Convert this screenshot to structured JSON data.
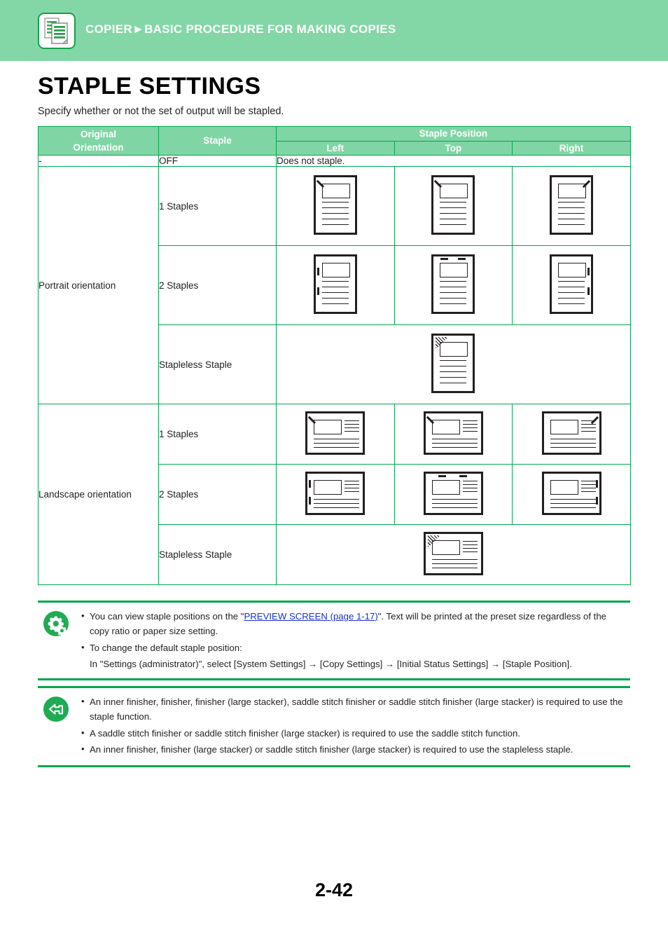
{
  "header": {
    "breadcrumb": "COPIER►BASIC PROCEDURE FOR MAKING COPIES",
    "icon": "copier-documents-icon",
    "band_color": "#83d7a6"
  },
  "page": {
    "title": "STAPLE SETTINGS",
    "subtitle": "Specify whether or not the set of output will be stapled.",
    "number": "2-42"
  },
  "table": {
    "headers": {
      "original_orientation": "Original\nOrientation",
      "original_orientation_line1": "Original",
      "original_orientation_line2": "Orientation",
      "staple": "Staple",
      "staple_position": "Staple Position",
      "left": "Left",
      "top": "Top",
      "right": "Right"
    },
    "rows": [
      {
        "orientation": "-",
        "staple": "OFF",
        "span_text": "Does not staple.",
        "type": "text"
      },
      {
        "orientation": "Portrait orientation",
        "staple": "1 Staples",
        "type": "illustration",
        "sheet": "portrait",
        "marks": [
          "diag-top-left",
          "diag-top-left",
          "diag-top-right"
        ]
      },
      {
        "orientation": "Portrait orientation",
        "staple": "2 Staples",
        "type": "illustration",
        "sheet": "portrait",
        "marks": [
          "two-vertical-left",
          "two-horizontal-top",
          "two-vertical-right"
        ]
      },
      {
        "orientation": "Portrait orientation",
        "staple": "Stapleless Staple",
        "type": "illustration-center",
        "sheet": "portrait",
        "marks": [
          "crimp-top-left"
        ]
      },
      {
        "orientation": "Landscape orientation",
        "staple": "1 Staples",
        "type": "illustration",
        "sheet": "landscape",
        "marks": [
          "diag-top-left",
          "diag-top-left",
          "diag-top-right"
        ]
      },
      {
        "orientation": "Landscape orientation",
        "staple": "2 Staples",
        "type": "illustration",
        "sheet": "landscape",
        "marks": [
          "two-vertical-left",
          "two-horizontal-top",
          "two-vertical-right"
        ]
      },
      {
        "orientation": "Landscape orientation",
        "staple": "Stapleless Staple",
        "type": "illustration-center",
        "sheet": "landscape",
        "marks": [
          "crimp-top-left"
        ]
      }
    ],
    "orientation_labels": {
      "portrait": "Portrait orientation",
      "landscape": "Landscape orientation"
    },
    "staple_labels": {
      "off": "OFF",
      "one": "1 Staples",
      "two": "2 Staples",
      "stapleless": "Stapleless Staple"
    },
    "off_description": "Does not staple."
  },
  "notes": [
    {
      "icon": "gears-icon",
      "icon_color": "#1eab54",
      "items": [
        {
          "pre": "You can view staple positions on the \"",
          "link": "PREVIEW SCREEN (page 1-17)",
          "post": "\". Text will be printed at the preset size regardless of the copy ratio or paper size setting."
        },
        {
          "pre": "To change the default staple position:",
          "sub": "In \"Settings (administrator)\", select [System Settings] → [Copy Settings] → [Initial Status Settings] → [Staple Position]."
        }
      ]
    },
    {
      "icon": "return-arrow-icon",
      "icon_color": "#1eab54",
      "items": [
        {
          "pre": "An inner finisher, finisher, finisher (large stacker), saddle stitch finisher or saddle stitch finisher (large stacker) is required to use the staple function."
        },
        {
          "pre": "A saddle stitch finisher or saddle stitch finisher (large stacker) is required to use the saddle stitch function."
        },
        {
          "pre": "An inner finisher, finisher (large stacker) or saddle stitch finisher (large stacker) is required to use the stapleless staple."
        }
      ]
    }
  ]
}
